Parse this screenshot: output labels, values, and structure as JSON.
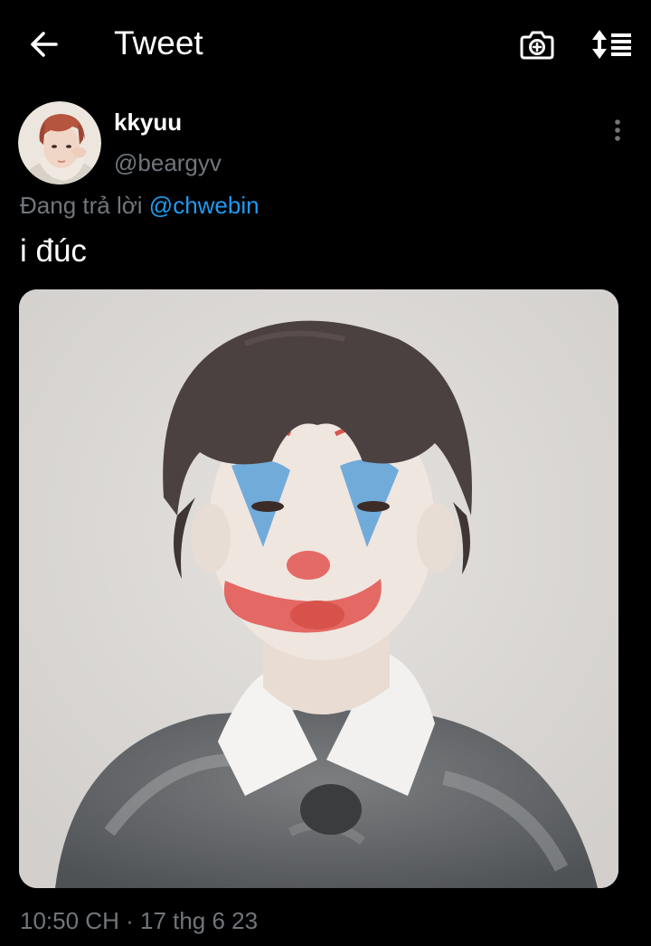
{
  "header": {
    "title": "Tweet",
    "back_icon": "arrow-left-icon",
    "camera_icon": "camera-plus-icon",
    "sort_icon": "sort-arrows-icon"
  },
  "tweet": {
    "author": {
      "display_name": "kkyuu",
      "handle": "@beargyv"
    },
    "reply_prefix": "Đang trả lời",
    "reply_to": "@chwebin",
    "text": "i đúc",
    "media": {
      "type": "photo",
      "alt_icon": "photo"
    },
    "time": "10:50 CH",
    "separator": "·",
    "date": "17 thg 6 23"
  },
  "colors": {
    "background": "#000000",
    "primary_text": "#ffffff",
    "secondary_text": "#71767b",
    "link": "#1d9bf0"
  }
}
